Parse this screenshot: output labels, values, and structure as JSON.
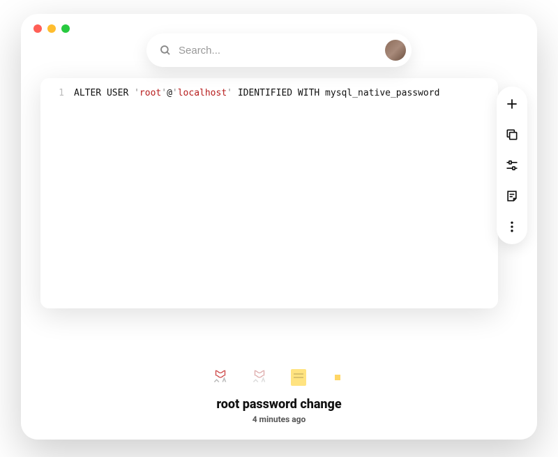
{
  "search": {
    "placeholder": "Search..."
  },
  "code": {
    "lines": [
      {
        "num": "1",
        "tokens": [
          {
            "t": "ALTER USER ",
            "c": "kw"
          },
          {
            "t": "'",
            "c": "strq"
          },
          {
            "t": "root",
            "c": "str"
          },
          {
            "t": "'",
            "c": "strq"
          },
          {
            "t": "@",
            "c": "kw"
          },
          {
            "t": "'",
            "c": "strq"
          },
          {
            "t": "localhost",
            "c": "str"
          },
          {
            "t": "'",
            "c": "strq"
          },
          {
            "t": " IDENTIFIED WITH mysql_native_password",
            "c": "kw"
          }
        ]
      }
    ]
  },
  "sidebar": {
    "add": "add-icon",
    "copy": "copy-icon",
    "sliders": "sliders-icon",
    "note": "note-icon",
    "more": "more-icon"
  },
  "snippet": {
    "title": "root password change",
    "time": "4 minutes ago"
  }
}
